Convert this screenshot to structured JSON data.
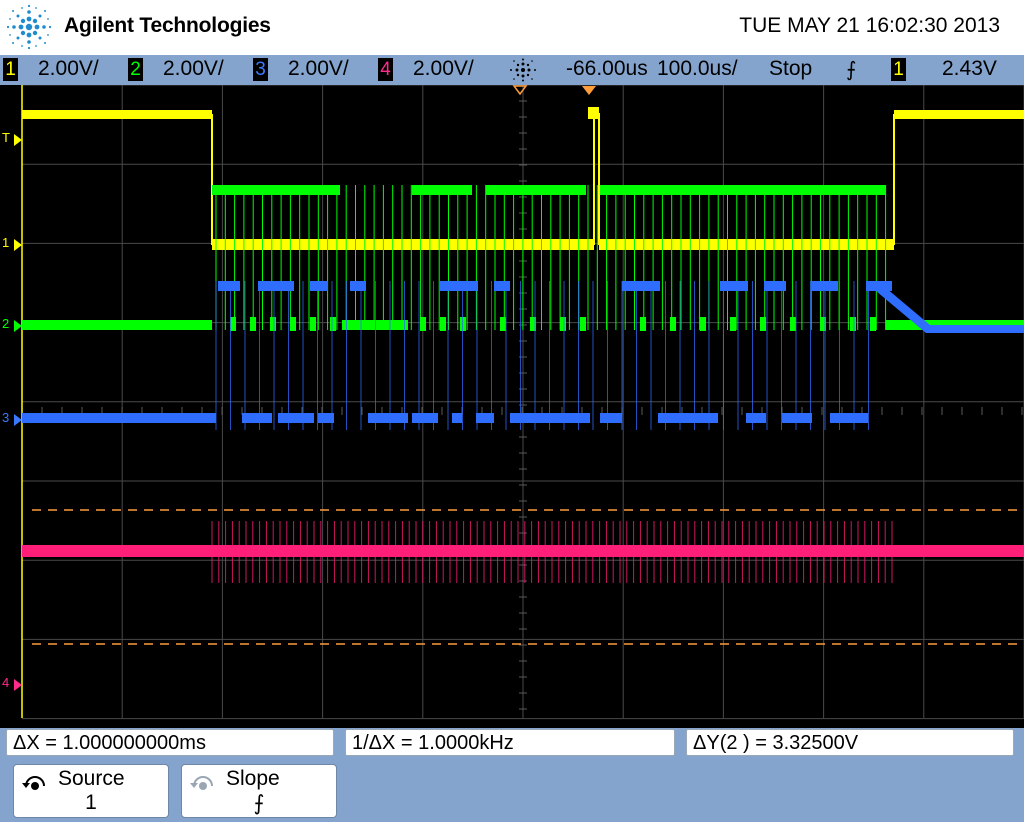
{
  "header": {
    "brand": "Agilent Technologies",
    "datetime": "TUE MAY 21 16:02:30 2013",
    "logo_icon": "agilent-spark-logo-icon"
  },
  "status_bar": {
    "channels": [
      {
        "number": "1",
        "scale": "2.00V/",
        "color": "#ffff00"
      },
      {
        "number": "2",
        "scale": "2.00V/",
        "color": "#00ff00"
      },
      {
        "number": "3",
        "scale": "2.00V/",
        "color": "#3a78ff"
      },
      {
        "number": "4",
        "scale": "2.00V/",
        "color": "#ff2a8a"
      }
    ],
    "acquire_icon": "acquisition-spark-icon",
    "delay": "-66.00us",
    "timebase": "100.0us/",
    "run_state": "Stop",
    "trigger_slope_icon": "rising-edge-icon",
    "trigger_slope_symbol": "⨍",
    "trigger_source": "1",
    "trigger_level": "2.43V"
  },
  "screen": {
    "channel_colors": {
      "ch1": "#ffff00",
      "ch2": "#00ff00",
      "ch3": "#2f6dff",
      "ch4": "#ff1e78",
      "cursor": "#ff9c3c"
    },
    "markers": [
      {
        "label": "T",
        "color": "#ffff00"
      },
      {
        "label": "1",
        "color": "#ffff00"
      },
      {
        "label": "2",
        "color": "#00ff00"
      },
      {
        "label": "3",
        "color": "#3a78ff"
      },
      {
        "label": "4",
        "color": "#ff2a8a"
      }
    ]
  },
  "measurements": {
    "delta_x": "ΔX = 1.000000000ms",
    "inverse_delta_x": "1/ΔX = 1.0000kHz",
    "delta_y": "ΔY(2 ) = 3.32500V"
  },
  "softkeys": {
    "source": {
      "label": "Source",
      "value": "1",
      "icon": "rotary-knob-icon"
    },
    "slope": {
      "label": "Slope",
      "value": "⨍",
      "icon": "rotary-knob-icon"
    }
  }
}
